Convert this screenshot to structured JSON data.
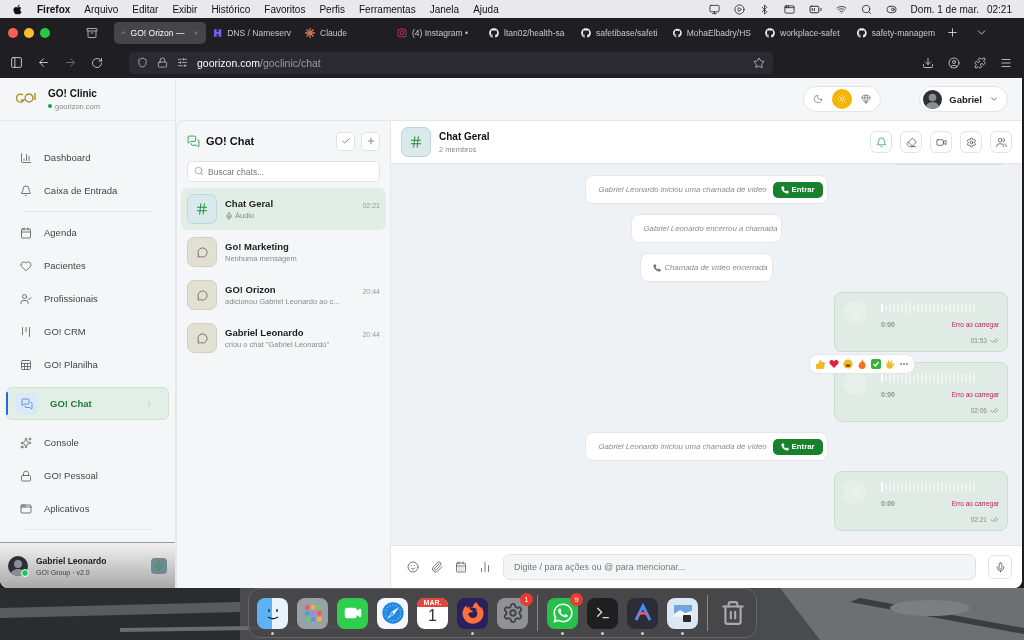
{
  "menu_bar": {
    "app": "Firefox",
    "items": [
      "Arquivo",
      "Editar",
      "Exibir",
      "Histórico",
      "Favoritos",
      "Perfis",
      "Ferramentas",
      "Janela",
      "Ajuda"
    ],
    "date": "Dom. 1 de mar.",
    "time": "02:21"
  },
  "browser": {
    "tabs": [
      {
        "title": "GO! Orizon —",
        "kind": "orizon",
        "selected": true
      },
      {
        "title": "DNS / Nameserv",
        "kind": "hostinger",
        "selected": false
      },
      {
        "title": "Claude",
        "kind": "claude",
        "selected": false
      },
      {
        "title": "(4) Instagram •",
        "kind": "instagram",
        "selected": false
      },
      {
        "title": "ltan02/health-sa",
        "kind": "github",
        "selected": false
      },
      {
        "title": "safetibase/safeti",
        "kind": "github",
        "selected": false
      },
      {
        "title": "MohaElbadry/HS",
        "kind": "github",
        "selected": false
      },
      {
        "title": "workplace-safet",
        "kind": "github",
        "selected": false
      },
      {
        "title": "safety-managem",
        "kind": "github",
        "selected": false
      }
    ],
    "url": {
      "host": "goorizon.com",
      "path": "/goclinic/chat"
    }
  },
  "brand": {
    "name": "GO! Clinic",
    "domain": "goorizon.com"
  },
  "sidebar": {
    "groups": [
      [
        {
          "label": "Dashboard",
          "kind": "chart",
          "selected": false
        },
        {
          "label": "Caixa de Entrada",
          "kind": "bell",
          "selected": false
        }
      ],
      [
        {
          "label": "Agenda",
          "kind": "calendar",
          "selected": false
        },
        {
          "label": "Pacientes",
          "kind": "heart",
          "selected": false
        },
        {
          "label": "Profissionais",
          "kind": "user-check",
          "selected": false
        },
        {
          "label": "GO! CRM",
          "kind": "kanban",
          "selected": false
        },
        {
          "label": "GO! Planilha",
          "kind": "sheet",
          "selected": false
        },
        {
          "label": "GO! Chat",
          "kind": "chat",
          "selected": true
        },
        {
          "label": "Console",
          "kind": "sparkles",
          "selected": false
        },
        {
          "label": "GO! Pessoal",
          "kind": "lock",
          "selected": false
        },
        {
          "label": "Aplicativos",
          "kind": "window",
          "selected": false
        }
      ]
    ]
  },
  "user_footer": {
    "name": "Gabriel Leonardo",
    "subtitle": "GO! Group · v2.0",
    "online": true
  },
  "topbar": {
    "theme": [
      {
        "kind": "moon",
        "selected": false
      },
      {
        "kind": "sun",
        "selected": true
      },
      {
        "kind": "gem",
        "selected": false
      }
    ],
    "user": "Gabriel"
  },
  "chat_list": {
    "title": "GO! Chat",
    "search": {
      "placeholder": "Buscar chats..."
    },
    "chats": [
      {
        "name": "Chat Geral",
        "kind": "channel",
        "preview": "Áudio",
        "audio": true,
        "time": "02:21",
        "selected": true
      },
      {
        "name": "Go! Marketing",
        "kind": "chat",
        "preview": "Nenhuma mensagem",
        "selected": false
      },
      {
        "name": "GO! Orizon",
        "kind": "chat",
        "preview": "adicionou Gabriel Leonardo ao c...",
        "time": "20:44",
        "selected": false
      },
      {
        "name": "Gabriel Leonardo",
        "kind": "chat",
        "preview": "criou o chat \"Gabriel Leonardo\"",
        "time": "20:44",
        "selected": false
      }
    ]
  },
  "chat": {
    "name": "Chat Geral",
    "subtitle": "2 membros",
    "actions": [
      {
        "kind": "bell"
      },
      {
        "kind": "eraser"
      },
      {
        "kind": "video"
      },
      {
        "kind": "settings"
      },
      {
        "kind": "users"
      }
    ],
    "messages": [
      {
        "kind": "clipped"
      },
      {
        "kind": "system",
        "text": "Gabriel Leonardo iniciou uma chamada de vídeo",
        "button": "Entrar"
      },
      {
        "kind": "system",
        "text": "Gabriel Leonardo encerrou a chamada"
      },
      {
        "kind": "system",
        "text": "Chamada de vídeo encerrada",
        "phone": true
      },
      {
        "kind": "audio",
        "duration": "0:00",
        "error": "Erro ao carregar",
        "time": "01:53"
      },
      {
        "kind": "audio",
        "duration": "0:00",
        "error": "Erro ao carregar",
        "time": "02:06",
        "reactions": true
      },
      {
        "kind": "system",
        "text": "Gabriel Leonardo iniciou uma chamada de vídeo",
        "button": "Entrar"
      },
      {
        "kind": "audio",
        "duration": "0:00",
        "error": "Erro ao carregar",
        "time": "02:21"
      }
    ],
    "composer": {
      "placeholder": "Digite / para ações ou @ para mencionar..."
    }
  },
  "dock": {
    "apps": [
      {
        "kind": "finder",
        "running": true
      },
      {
        "kind": "launchpad",
        "running": false
      },
      {
        "kind": "facetime",
        "running": false
      },
      {
        "kind": "safari",
        "running": false
      },
      {
        "kind": "calendar",
        "month": "MAR.",
        "day": "1",
        "running": false
      },
      {
        "kind": "firefox",
        "running": true
      },
      {
        "kind": "settings",
        "badge": "1",
        "running": false
      },
      {
        "kind": "divider"
      },
      {
        "kind": "whatsapp",
        "badge": "9",
        "running": true
      },
      {
        "kind": "terminal",
        "running": true
      },
      {
        "kind": "arc",
        "running": true
      },
      {
        "kind": "preview",
        "running": true
      },
      {
        "kind": "divider"
      },
      {
        "kind": "trash",
        "running": false
      }
    ]
  }
}
